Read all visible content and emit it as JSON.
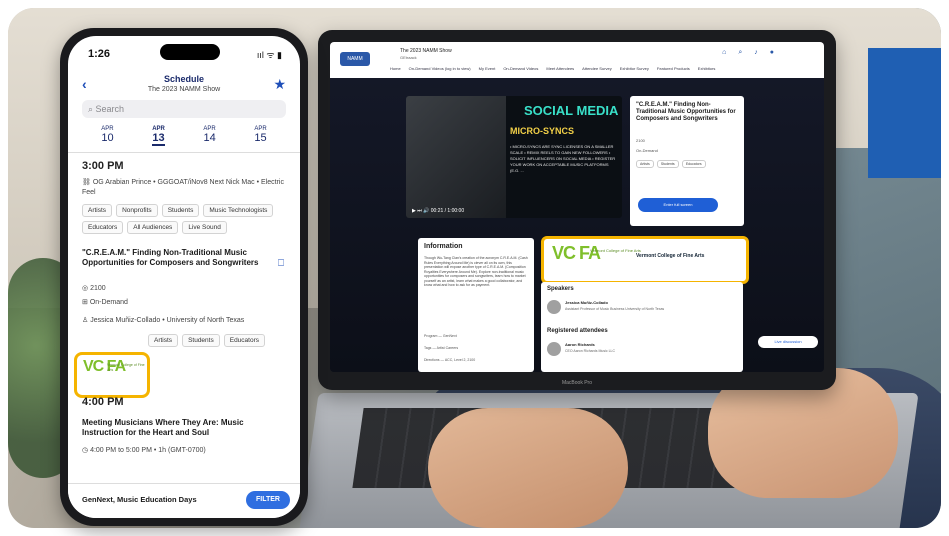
{
  "phone": {
    "status_time": "1:26",
    "status_icons": "ııl ᯤ ▮",
    "header": {
      "title": "Schedule",
      "subtitle": "The 2023 NAMM Show"
    },
    "search_placeholder": "Search",
    "days": [
      {
        "month": "APR",
        "day": "10"
      },
      {
        "month": "APR",
        "day": "13"
      },
      {
        "month": "APR",
        "day": "14"
      },
      {
        "month": "APR",
        "day": "15"
      }
    ],
    "time_slot_1": "3:00 PM",
    "session_1_performers": "OG Arabian Prince • GGGOAT/iNov8 Next Nick Mac • Electric Feel",
    "session_1_tags": [
      "Artists",
      "Nonprofits",
      "Students",
      "Music Technologists",
      "Educators",
      "All Audiences",
      "Live Sound"
    ],
    "session_2_title": "\"C.R.E.A.M.\" Finding Non-Traditional Music Opportunities for Composers and Songwriters",
    "session_2_room": "2100",
    "session_2_mode": "On-Demand",
    "session_2_speaker": "Jessica Muñiz-Collado • University of North Texas",
    "session_2_tags": [
      "Artists",
      "Students",
      "Educators"
    ],
    "sponsor_logo_mark": "VC FA",
    "sponsor_logo_text": "Vermont College of Fine Arts",
    "time_slot_2": "4:00 PM",
    "session_3_title": "Meeting Musicians Where They Are: Music Instruction for the Heart and Soul",
    "session_3_time": "4:00 PM to 5:00 PM • 1h (GMT-0700)",
    "footer_label": "GenNext, Music Education Days",
    "filter_label": "FILTER"
  },
  "laptop": {
    "logo_text": "NAMM",
    "event_title": "The 2023 NAMM Show",
    "event_subtitle": "GEtraack",
    "nav_items": [
      "Home",
      "On-Demand Videos (log in to view)",
      "My Event",
      "On-Demand Videos",
      "Meet Attendees",
      "Attendee Survey",
      "Exhibitor Survey",
      "Featured Products",
      "Exhibitors"
    ],
    "video": {
      "heading": "SOCIAL MEDIA",
      "subheading": "MICRO-SYNCS",
      "bullets": "• MICRO-SYNCS ARE SYNC LICENSES ON A SMALLER SCALE • REMIX REELS TO GAIN NEW FOLLOWERS • SOLICIT INFLUENCERS ON SOCIAL MEDIA • REGISTER YOUR WORK ON ACCEPTABLE MUSIC PLATFORMS (E.G. ...",
      "controls": "▶ ⏭ 🔊 00:21 / 1:00:00"
    },
    "side_card": {
      "title": "\"C.R.E.A.M.\" Finding Non-Traditional Music Opportunities for Composers and Songwriters",
      "room": "2100",
      "mode": "On-Demand",
      "tags": [
        "Artists",
        "Students",
        "Educators"
      ],
      "enter_label": "Enter full screen"
    },
    "info_card": {
      "heading": "Information",
      "body": "Though Wu-Tang Clan's creation of the acronym C.R.E.A.M. (Cash Rules Everything Around Me) is clever all on its own, this presentation will expose another type of C.R.E.A.M. (Composition Royalties Everywhere Around Me). Explore non-traditional music opportunities for composers and songwriters, learn how to market yourself as an artist, learn what makes a good collaborator, and know what and how to ask for as payment.",
      "rows": [
        {
          "label": "Program",
          "value": "GenNext"
        },
        {
          "label": "Tags",
          "value": "Artist  Careers"
        },
        {
          "label": "Directions",
          "value": "ACC, Level 2, 2100"
        }
      ]
    },
    "sponsor": {
      "mark": "VC FA",
      "small_text": "Vermont College of Fine Arts",
      "name": "Vermont College of Fine Arts"
    },
    "speakers": {
      "heading": "Speakers",
      "speaker_name": "Jessica Muñiz-Collado",
      "speaker_role": "Assistant Professor of Music Business University of North Texas",
      "registered_heading": "Registered attendees",
      "attendee_name": "Aaron Richards",
      "attendee_role": "CEO Aaron Richards Music LLC"
    },
    "live_chip": "Live discussion",
    "brand": "MacBook Pro"
  }
}
